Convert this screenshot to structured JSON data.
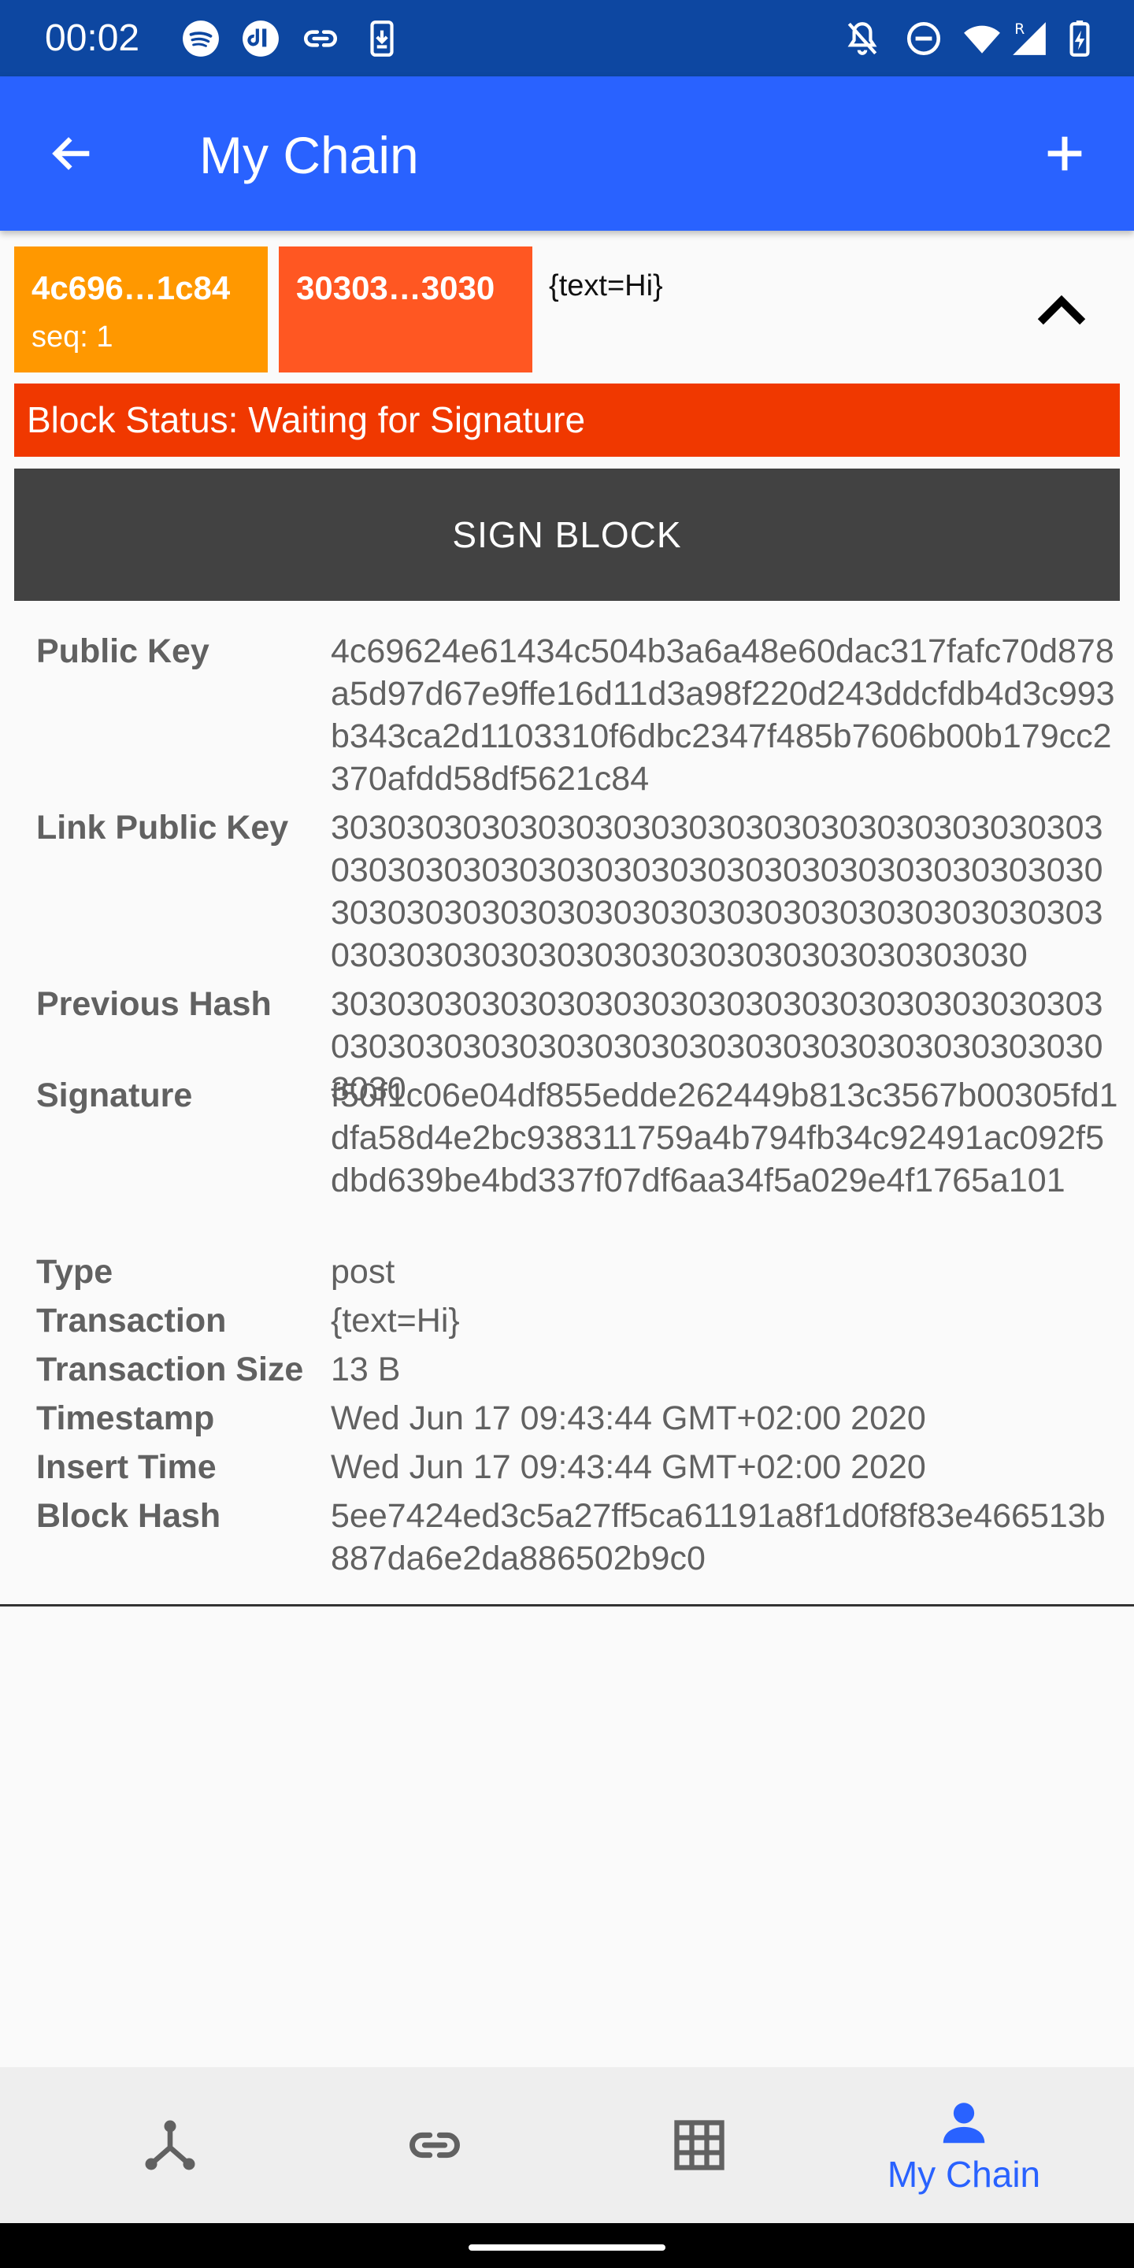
{
  "status_bar": {
    "time": "00:02",
    "left_icons": [
      "spotify-icon",
      "app-icon",
      "link-icon",
      "download-icon"
    ],
    "right_icons": [
      "notifications-off-icon",
      "do-not-disturb-icon",
      "wifi-icon",
      "signal-roaming-icon",
      "battery-charging-icon"
    ],
    "roaming_label": "R"
  },
  "app_bar": {
    "title": "My Chain",
    "color": "#2962FF"
  },
  "block": {
    "public_key_short": "4c696…1c84",
    "sequence": "seq: 1",
    "link_key_short": "30303…3030",
    "transaction_preview": "{text=Hi}",
    "status": "Block Status: Waiting for Signature",
    "sign_button": "SIGN BLOCK",
    "colors": {
      "public_key_chip": "#FF9800",
      "link_key_chip": "#FF5722",
      "status_banner": "#F03800",
      "sign_button": "#424242"
    }
  },
  "details": [
    {
      "label": "Public Key",
      "value": "4c69624e61434c504b3a6a48e60dac317fafc70d878a5d97d67e9ffe16d11d3a98f220d243ddcfdb4d3c993b343ca2d1103310f6dbc2347f485b7606b00b179cc2370afdd58df5621c84"
    },
    {
      "label": "Link Public Key",
      "value": "3030303030303030303030303030303030303030303030303030303030303030303030303030303030303030303030303030303030303030303030303030303030303030303030303030303030303030"
    },
    {
      "label": "Previous Hash",
      "value": "30303030303030303030303030303030303030303030303030303030303030303030303030303030303030"
    },
    {
      "label": "Signature",
      "value": "f50f1c06e04df855edde262449b813c3567b00305fd1dfa58d4e2bc938311759a4b794fb34c92491ac092f5dbd639be4bd337f07df6aa34f5a029e4f1765a101"
    },
    {
      "label": "Type",
      "value": "post"
    },
    {
      "label": "Transaction",
      "value": "{text=Hi}"
    },
    {
      "label": "Transaction Size",
      "value": "13 B"
    },
    {
      "label": "Timestamp",
      "value": "Wed Jun 17 09:43:44 GMT+02:00 2020"
    },
    {
      "label": "Insert Time",
      "value": "Wed Jun 17 09:43:44 GMT+02:00 2020"
    },
    {
      "label": "Block Hash",
      "value": "5ee7424ed3c5a27ff5ca61191a8f1d0f8f83e466513b887da6e2da886502b9c0"
    }
  ],
  "bottom_nav": {
    "items": [
      {
        "icon": "network-icon",
        "label": ""
      },
      {
        "icon": "link-icon",
        "label": ""
      },
      {
        "icon": "grid-icon",
        "label": ""
      },
      {
        "icon": "person-icon",
        "label": "My Chain",
        "selected": true
      }
    ],
    "selected_color": "#2962FF",
    "icon_color": "#616161"
  }
}
